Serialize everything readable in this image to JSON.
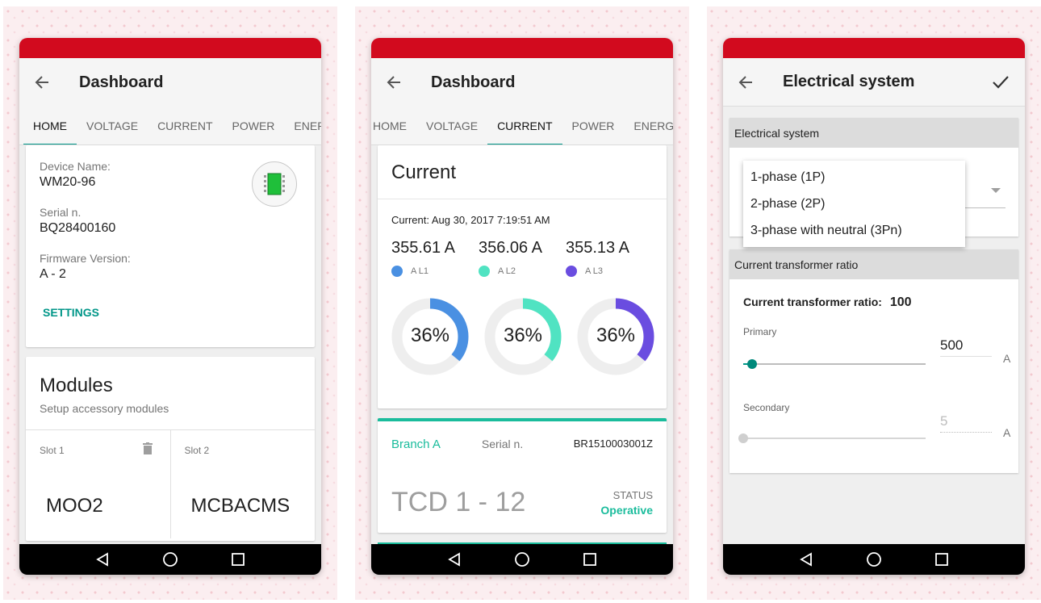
{
  "screens": {
    "home": {
      "title": "Dashboard",
      "tabs": [
        "HOME",
        "VOLTAGE",
        "CURRENT",
        "POWER",
        "ENER"
      ],
      "device": {
        "name_label": "Device Name:",
        "name": "WM20-96",
        "serial_label": "Serial n.",
        "serial": "BQ28400160",
        "firmware_label": "Firmware Version:",
        "firmware": "A - 2",
        "settings": "SETTINGS"
      },
      "modules": {
        "title": "Modules",
        "subtitle": "Setup accessory modules",
        "slots": [
          {
            "label": "Slot 1",
            "value": "MOO2"
          },
          {
            "label": "Slot 2",
            "value": "MCBACMS"
          }
        ]
      }
    },
    "current": {
      "title": "Dashboard",
      "tabs": [
        "HOME",
        "VOLTAGE",
        "CURRENT",
        "POWER",
        "ENERGY"
      ],
      "card_title": "Current",
      "timestamp": "Current: Aug 30, 2017 7:19:51 AM",
      "phases": [
        {
          "value": "355.61 A",
          "legend": "A L1",
          "color": "#4a90e2",
          "percent_label": "36%",
          "percent": 0.36
        },
        {
          "value": "356.06 A",
          "legend": "A L2",
          "color": "#50e3c2",
          "percent_label": "36%",
          "percent": 0.36
        },
        {
          "value": "355.13 A",
          "legend": "A L3",
          "color": "#6a4de0",
          "percent_label": "36%",
          "percent": 0.36
        }
      ],
      "branch": {
        "name": "Branch A",
        "serial_label": "Serial n.",
        "serial": "BR1510003001Z",
        "tcd": "TCD 1 - 12",
        "status_label": "STATUS",
        "status": "Operative"
      }
    },
    "electrical": {
      "title": "Electrical system",
      "section1_header": "Electrical system",
      "menu_options": [
        "1-phase (1P)",
        "2-phase (2P)",
        "3-phase with neutral (3Pn)"
      ],
      "section2_header": "Current transformer ratio",
      "ratio_label": "Current transformer ratio:",
      "ratio_value": "100",
      "primary": {
        "label": "Primary",
        "value": "500",
        "unit": "A",
        "level": 0.05
      },
      "secondary": {
        "label": "Secondary",
        "value": "5",
        "unit": "A",
        "level": 0.0
      }
    }
  },
  "colors": {
    "statusbar": "#d20a1e",
    "accent": "#009688",
    "branch": "#1abc9c"
  },
  "icons": {
    "back": "arrow-left-icon",
    "check": "check-icon",
    "trash": "trash-icon",
    "device": "device-module-icon",
    "nav": [
      "nav-back-icon",
      "nav-home-icon",
      "nav-recents-icon"
    ]
  }
}
